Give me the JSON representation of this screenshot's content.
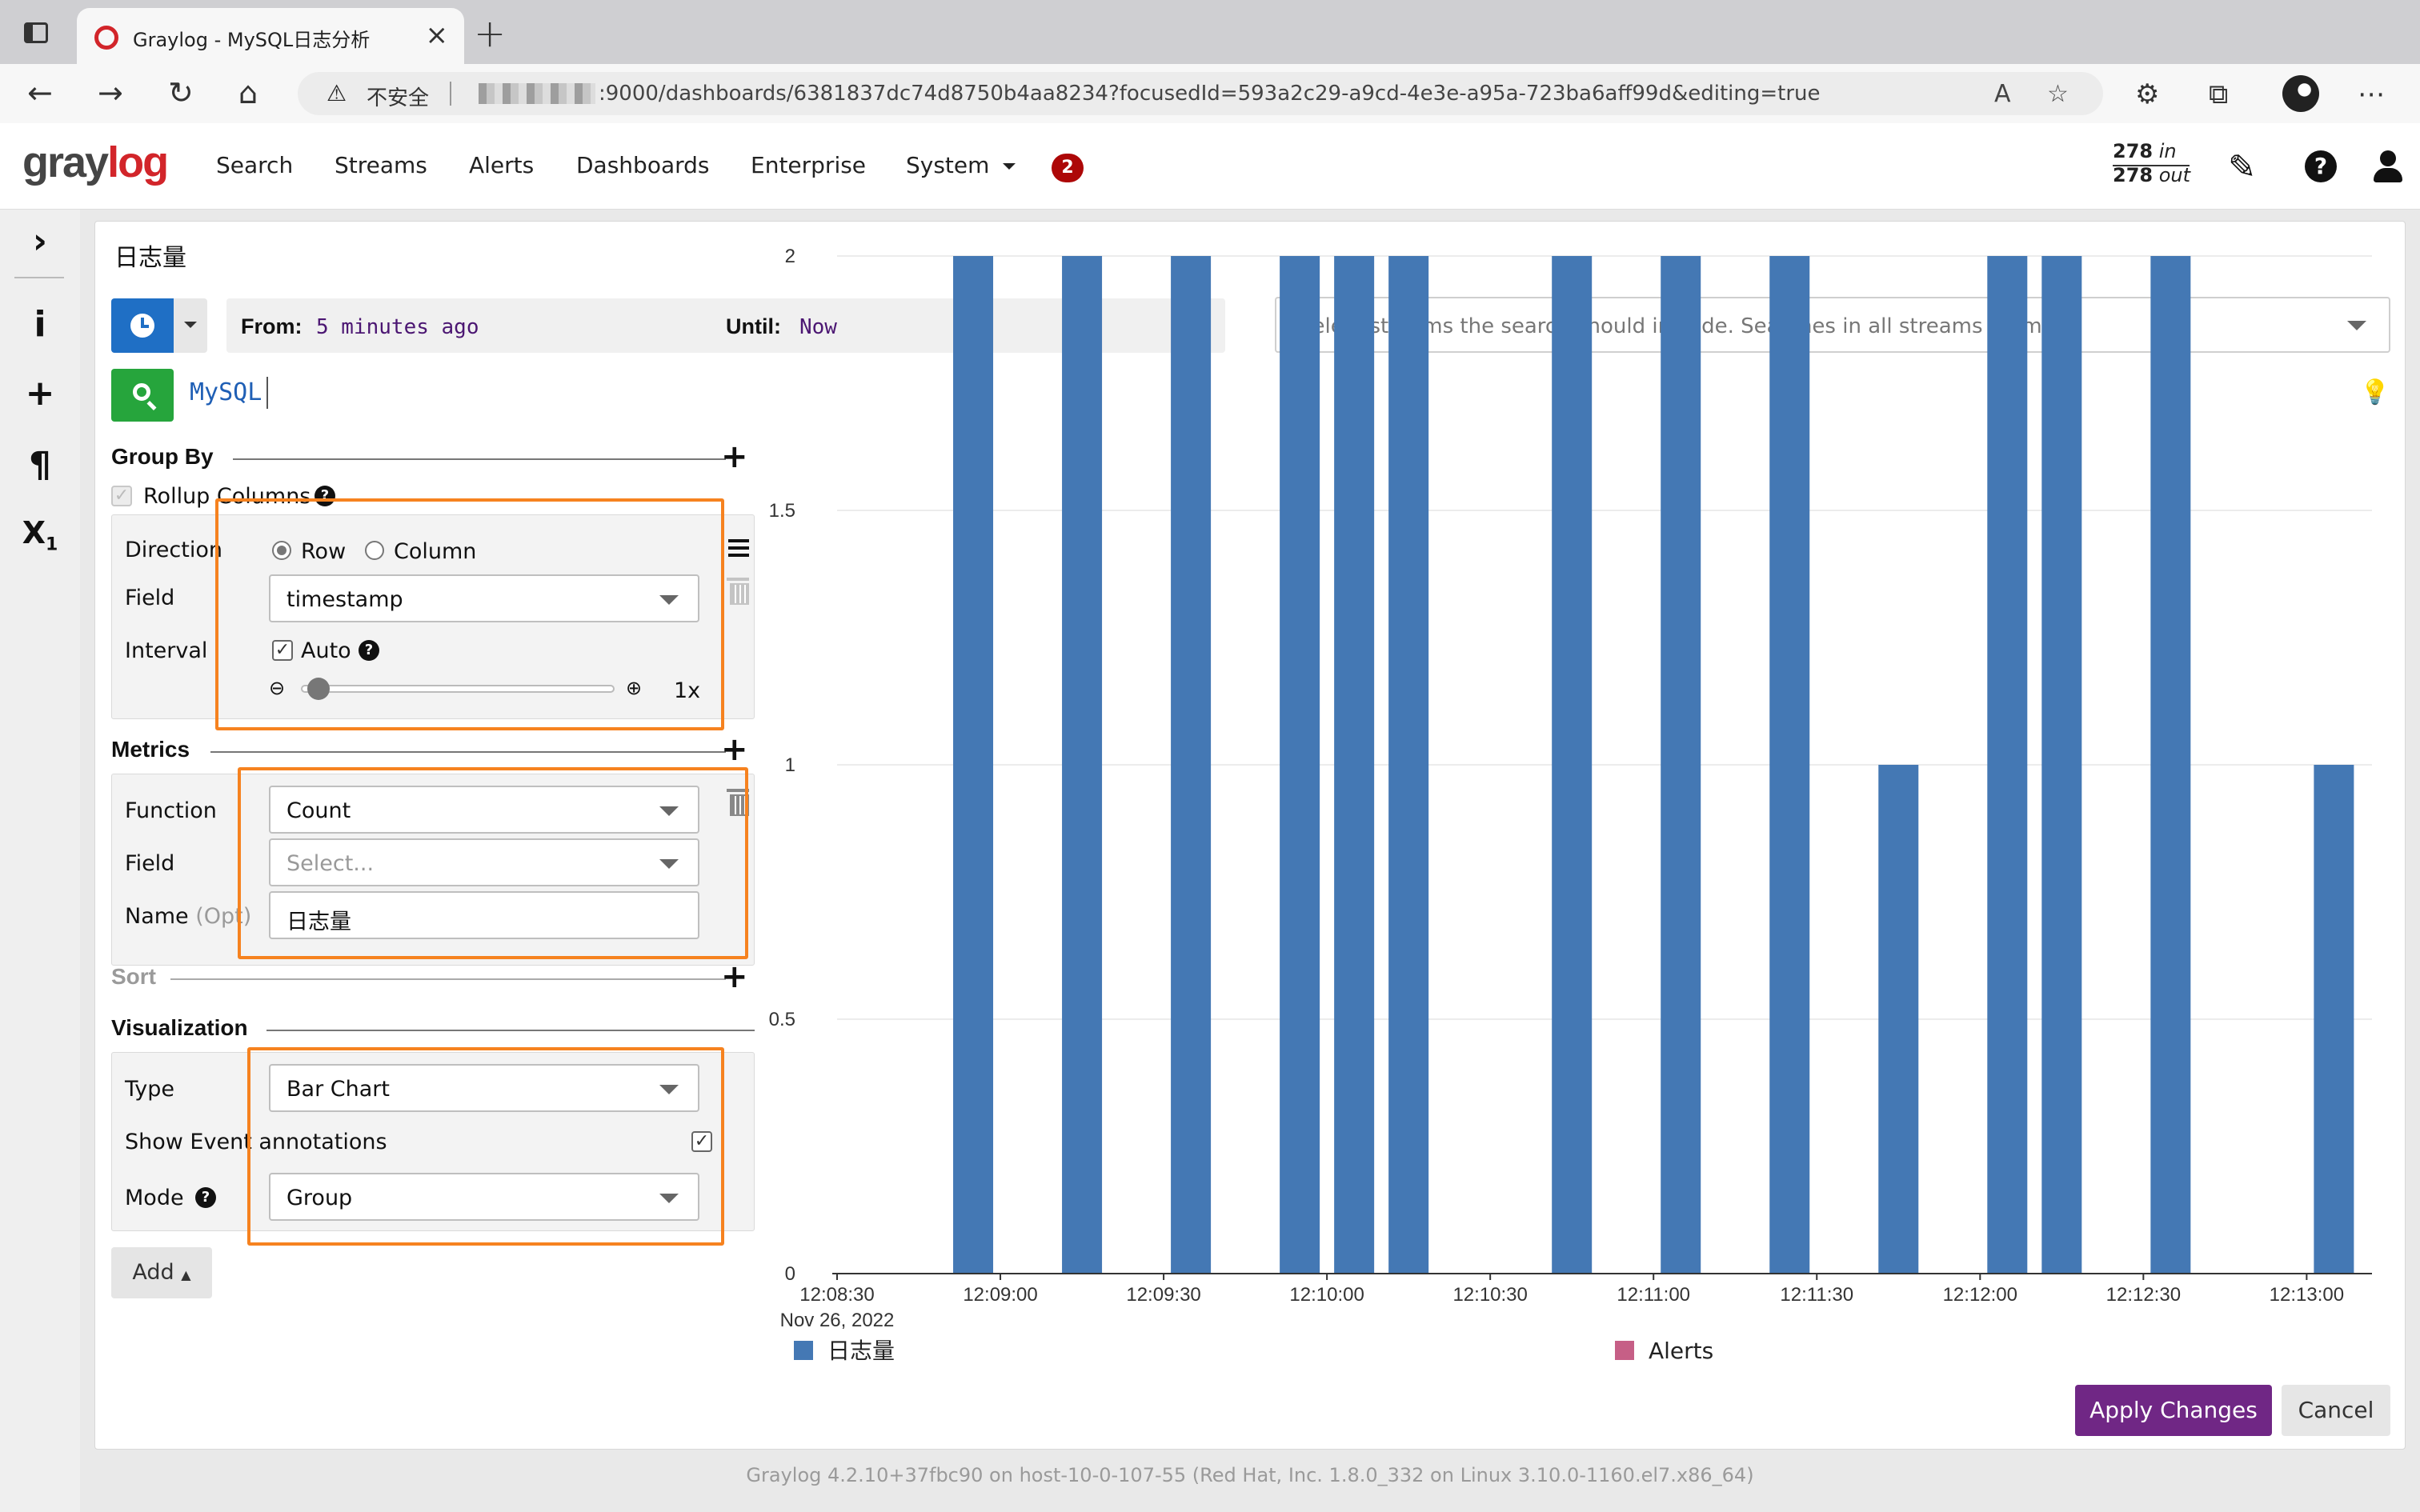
{
  "browser": {
    "tab_title": "Graylog - MySQL日志分析",
    "security_label": "不安全",
    "url": ":9000/dashboards/6381837dc74d8750b4aa8234?focusedId=593a2c29-a9cd-4e3e-a95a-723ba6aff99d&editing=true"
  },
  "nav": {
    "logo_a": "gray",
    "logo_b": "log",
    "items": [
      "Search",
      "Streams",
      "Alerts",
      "Dashboards",
      "Enterprise",
      "System"
    ],
    "notification_count": "2",
    "throughput_in_num": "278",
    "throughput_in_word": "in",
    "throughput_out_num": "278",
    "throughput_out_word": "out"
  },
  "sidebar": {
    "icons": [
      "chevron-right-icon",
      "info-icon",
      "plus-icon",
      "paragraph-icon",
      "subscript-icon"
    ]
  },
  "widget": {
    "title": "日志量",
    "from_label": "From:",
    "from_value": "5 minutes ago",
    "until_label": "Until:",
    "until_value": "Now",
    "streams_placeholder": "Select streams the search should include. Searches in all streams if empty.",
    "query": "MySQL"
  },
  "group_by": {
    "title": "Group By",
    "rollup_label": "Rollup Columns",
    "direction_label": "Direction",
    "direction_options": [
      "Row",
      "Column"
    ],
    "direction_selected": "Row",
    "field_label": "Field",
    "field_value": "timestamp",
    "interval_label": "Interval",
    "auto_label": "Auto",
    "auto_checked": true,
    "zoom_value": "1x"
  },
  "metrics": {
    "title": "Metrics",
    "function_label": "Function",
    "function_value": "Count",
    "field_label": "Field",
    "field_placeholder": "Select...",
    "name_label": "Name",
    "name_optional": "(Opt)",
    "name_value": "日志量"
  },
  "sort": {
    "title": "Sort"
  },
  "visualization": {
    "title": "Visualization",
    "type_label": "Type",
    "type_value": "Bar Chart",
    "event_annotations_label": "Show Event annotations",
    "event_annotations_checked": true,
    "mode_label": "Mode",
    "mode_value": "Group"
  },
  "buttons": {
    "add": "Add",
    "apply": "Apply Changes",
    "cancel": "Cancel"
  },
  "chart_data": {
    "type": "bar",
    "x_ticks": [
      "12:08:30",
      "12:09:00",
      "12:09:30",
      "12:10:00",
      "12:10:30",
      "12:11:00",
      "12:11:30",
      "12:12:00",
      "12:12:30",
      "12:13:00"
    ],
    "x_date_label": "Nov 26, 2022",
    "y_ticks": [
      "0",
      "0.5",
      "1",
      "1.5",
      "2"
    ],
    "ylim": [
      0,
      2
    ],
    "x_range": [
      "12:08:30",
      "12:13:12"
    ],
    "series": [
      {
        "name": "日志量",
        "color": "#4478b4",
        "points": [
          {
            "x": "12:08:55",
            "y": 2
          },
          {
            "x": "12:09:15",
            "y": 2
          },
          {
            "x": "12:09:35",
            "y": 2
          },
          {
            "x": "12:09:55",
            "y": 2
          },
          {
            "x": "12:10:05",
            "y": 2
          },
          {
            "x": "12:10:15",
            "y": 2
          },
          {
            "x": "12:10:45",
            "y": 2
          },
          {
            "x": "12:11:05",
            "y": 2
          },
          {
            "x": "12:11:25",
            "y": 2
          },
          {
            "x": "12:11:45",
            "y": 1
          },
          {
            "x": "12:12:05",
            "y": 2
          },
          {
            "x": "12:12:15",
            "y": 2
          },
          {
            "x": "12:12:35",
            "y": 2
          },
          {
            "x": "12:13:05",
            "y": 1
          }
        ]
      },
      {
        "name": "Alerts",
        "color": "#c65f86",
        "points": []
      }
    ],
    "legend_position": "bottom"
  },
  "footer": "Graylog 4.2.10+37fbc90 on host-10-0-107-55 (Red Hat, Inc. 1.8.0_332 on Linux 3.10.0-1160.el7.x86_64)"
}
